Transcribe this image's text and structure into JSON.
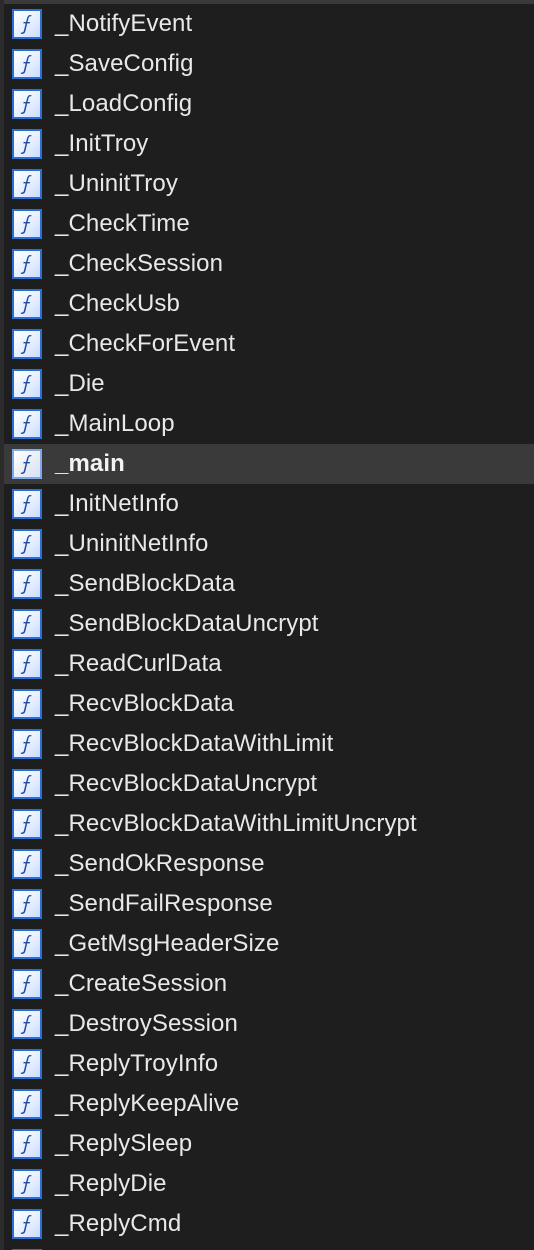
{
  "functions": {
    "items": [
      {
        "label": "_NotifyEvent",
        "icon": "function-icon"
      },
      {
        "label": "_SaveConfig",
        "icon": "function-icon"
      },
      {
        "label": "_LoadConfig",
        "icon": "function-icon"
      },
      {
        "label": "_InitTroy",
        "icon": "function-icon"
      },
      {
        "label": "_UninitTroy",
        "icon": "function-icon"
      },
      {
        "label": "_CheckTime",
        "icon": "function-icon"
      },
      {
        "label": "_CheckSession",
        "icon": "function-icon"
      },
      {
        "label": "_CheckUsb",
        "icon": "function-icon"
      },
      {
        "label": "_CheckForEvent",
        "icon": "function-icon"
      },
      {
        "label": "_Die",
        "icon": "function-icon"
      },
      {
        "label": "_MainLoop",
        "icon": "function-icon"
      },
      {
        "label": "_main",
        "icon": "function-icon",
        "selected": true
      },
      {
        "label": "_InitNetInfo",
        "icon": "function-icon"
      },
      {
        "label": "_UninitNetInfo",
        "icon": "function-icon"
      },
      {
        "label": "_SendBlockData",
        "icon": "function-icon"
      },
      {
        "label": "_SendBlockDataUncrypt",
        "icon": "function-icon"
      },
      {
        "label": "_ReadCurlData",
        "icon": "function-icon"
      },
      {
        "label": "_RecvBlockData",
        "icon": "function-icon"
      },
      {
        "label": "_RecvBlockDataWithLimit",
        "icon": "function-icon"
      },
      {
        "label": "_RecvBlockDataUncrypt",
        "icon": "function-icon"
      },
      {
        "label": "_RecvBlockDataWithLimitUncrypt",
        "icon": "function-icon"
      },
      {
        "label": "_SendOkResponse",
        "icon": "function-icon"
      },
      {
        "label": "_SendFailResponse",
        "icon": "function-icon"
      },
      {
        "label": "_GetMsgHeaderSize",
        "icon": "function-icon"
      },
      {
        "label": "_CreateSession",
        "icon": "function-icon"
      },
      {
        "label": "_DestroySession",
        "icon": "function-icon"
      },
      {
        "label": "_ReplyTroyInfo",
        "icon": "function-icon"
      },
      {
        "label": "_ReplyKeepAlive",
        "icon": "function-icon"
      },
      {
        "label": "_ReplySleep",
        "icon": "function-icon"
      },
      {
        "label": "_ReplyDie",
        "icon": "function-icon"
      },
      {
        "label": "_ReplyCmd",
        "icon": "function-icon"
      }
    ]
  },
  "colors": {
    "background": "#1e1e1e",
    "selected_row": "#3a3a3b",
    "icon_border": "#2b6fd6",
    "text": "#e8e8e8"
  }
}
